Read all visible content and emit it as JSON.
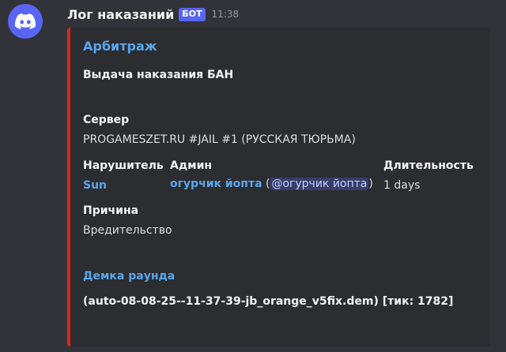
{
  "message": {
    "username": "Лог наказаний",
    "bot_tag": "БОТ",
    "timestamp": "11:38",
    "avatar_icon": "discord-logo-icon"
  },
  "embed": {
    "accent_color": "#e02323",
    "title": "Арбитраж",
    "description": "Выдача наказания БАН",
    "server": {
      "name": "Сервер",
      "value": "PROGAMESZET.RU #JAIL #1 (РУССКАЯ ТЮРЬМА)"
    },
    "violator": {
      "name": "Нарушитель",
      "value": "Sun"
    },
    "admin": {
      "name": "Админ",
      "value": "огурчик йопта",
      "paren_open": " (",
      "mention": "@огурчик йопта",
      "paren_close": ")"
    },
    "duration": {
      "name": "Длительность",
      "value": "1 days"
    },
    "reason": {
      "name": "Причина",
      "value": "Вредительство"
    },
    "demo": {
      "name": "Демка раунда",
      "value": "(auto-08-08-25--11-37-39-jb_orange_v5fix.dem) [тик: 1782]"
    }
  }
}
